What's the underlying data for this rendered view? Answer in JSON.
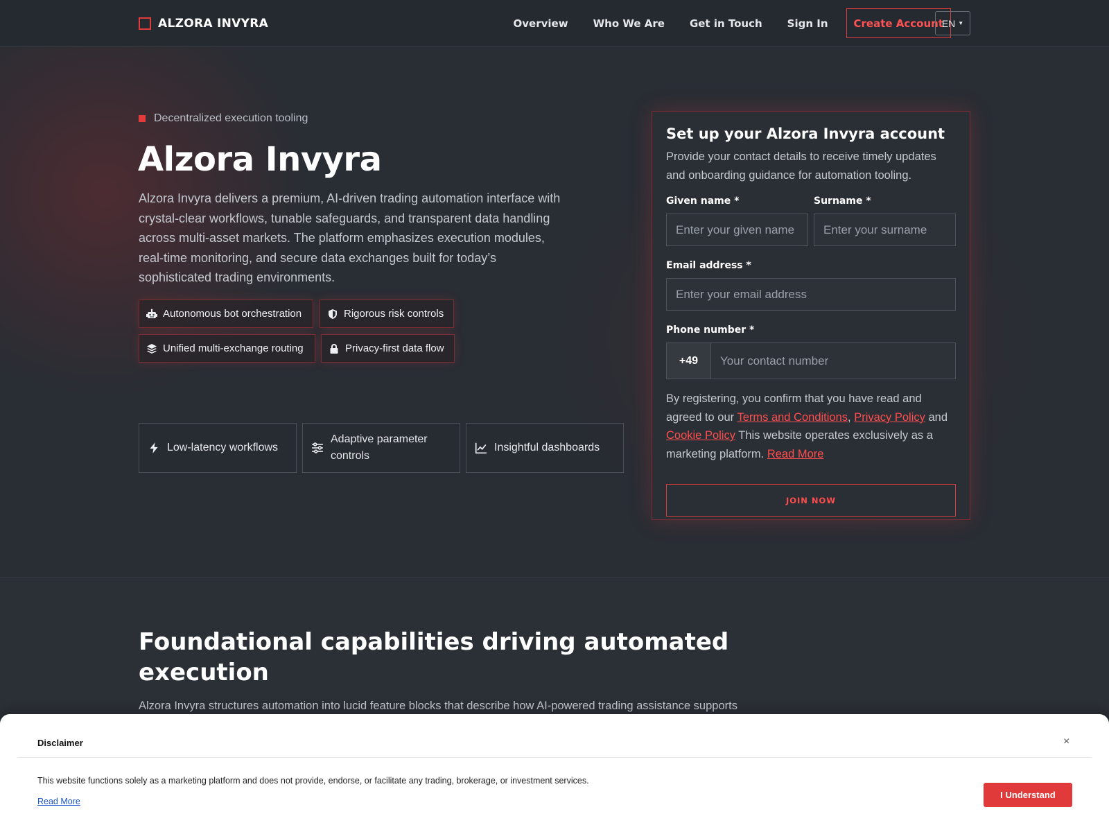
{
  "header": {
    "brand": "ALZORA INVYRA",
    "nav": [
      "Overview",
      "Who We Are",
      "Get in Touch",
      "Sign In"
    ],
    "cta": "Create Account",
    "lang": "EN"
  },
  "hero": {
    "eyebrow": "Decentralized execution tooling",
    "title": "Alzora Invyra",
    "description": "Alzora Invyra delivers a premium, AI-driven trading automation interface with crystal-clear workflows, tunable safeguards, and transparent data handling across multi-asset markets. The platform emphasizes execution modules, real-time monitoring, and secure data exchanges built for today’s sophisticated trading environments.",
    "chips": [
      {
        "label": "Autonomous bot orchestration",
        "icon": "robot-icon"
      },
      {
        "label": "Rigorous risk controls",
        "icon": "shield-icon"
      },
      {
        "label": "Unified multi-exchange routing",
        "icon": "layers-icon"
      },
      {
        "label": "Privacy-first data flow",
        "icon": "lock-icon"
      }
    ],
    "cards": [
      {
        "label": "Low-latency workflows",
        "icon": "bolt-icon"
      },
      {
        "label": "Adaptive parameter controls",
        "icon": "sliders-icon"
      },
      {
        "label": "Insightful dashboards",
        "icon": "line-chart-icon"
      }
    ]
  },
  "form": {
    "title": "Set up your Alzora Invyra account",
    "subtitle": "Provide your contact details to receive timely updates and onboarding guidance for automation tooling.",
    "given_label": "Given name",
    "given_placeholder": "Enter your given name",
    "surname_label": "Surname",
    "surname_placeholder": "Enter your surname",
    "email_label": "Email address",
    "email_placeholder": "Enter your email address",
    "phone_label": "Phone number",
    "phone_prefix": "+49",
    "phone_placeholder": "Your contact number",
    "required_mark": "*",
    "consent_pre": "By registering, you confirm that you have read and agreed to our ",
    "terms": "Terms and Conditions",
    "comma": ", ",
    "privacy": "Privacy Policy",
    "and": " and ",
    "cookie": "Cookie Policy",
    "consent_post": " This website operates exclusively as a marketing platform. ",
    "read_more": "Read More",
    "submit": "JOIN NOW"
  },
  "capabilities": {
    "title": "Foundational capabilities driving automated execution",
    "description": "Alzora Invyra structures automation into lucid feature blocks that describe how AI-powered trading assistance supports"
  },
  "disclaimer": {
    "title": "Disclaimer",
    "close": "×",
    "text": "This website functions solely as a marketing platform and does not provide, endorse, or facilitate any trading, brokerage, or investment services.",
    "link": "Read More",
    "button": "I Understand"
  },
  "colors": {
    "accent": "#e23b3b",
    "background": "#2b2f36",
    "header": "#252a30"
  }
}
